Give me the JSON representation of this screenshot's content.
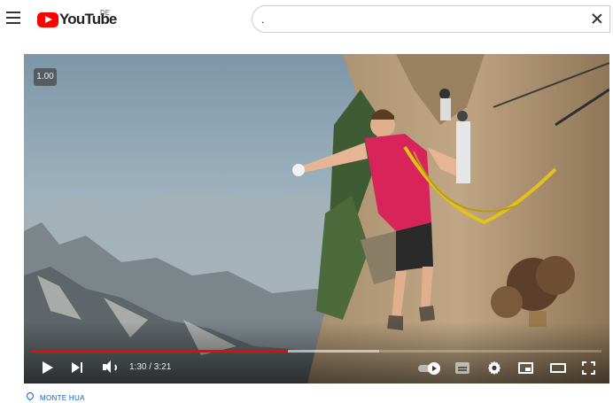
{
  "header": {
    "logo_text": "YouTube",
    "region_code": "DE",
    "search_value": "."
  },
  "player": {
    "speed_badge": "1.00",
    "time_display": "1:30 / 3:21",
    "progress_played": 0.45,
    "progress_loaded": 0.61,
    "accent_color": "#ff0000"
  },
  "video_meta": {
    "location_label": "MONTE HUA"
  },
  "icons": [
    "menu-icon",
    "youtube-logo-icon",
    "clear-icon",
    "play-icon",
    "next-icon",
    "volume-icon",
    "autoplay-toggle-icon",
    "subtitles-icon",
    "settings-icon",
    "miniplayer-icon",
    "theater-icon",
    "fullscreen-icon",
    "location-pin-icon"
  ]
}
